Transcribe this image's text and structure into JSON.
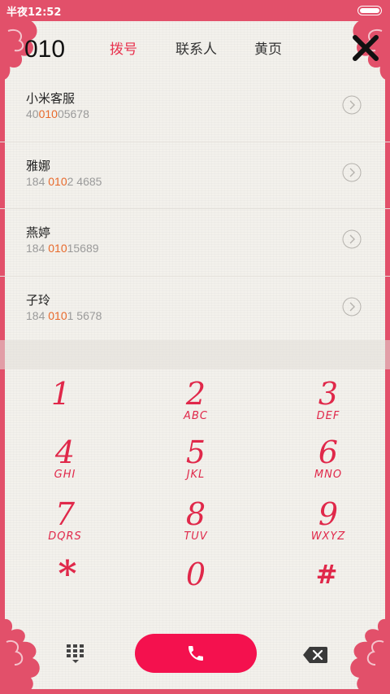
{
  "status_bar": {
    "time": "半夜12:52",
    "battery_icon": "battery-icon"
  },
  "colors": {
    "accent": "#e8334f",
    "frame": "#e2506a",
    "call": "#f4114e",
    "highlight": "#e8692b"
  },
  "header": {
    "dialed_number": "010",
    "tabs": [
      {
        "label": "拨号",
        "active": true
      },
      {
        "label": "联系人",
        "active": false
      },
      {
        "label": "黄页",
        "active": false
      }
    ],
    "close_icon": "close-icon"
  },
  "results": [
    {
      "name": "小米客服",
      "num_pre": "40",
      "num_match": "010",
      "num_post": "05678"
    },
    {
      "name": "雅娜",
      "num_pre": "184 ",
      "num_match": "010",
      "num_post": "2 4685"
    },
    {
      "name": "燕婷",
      "num_pre": "184 ",
      "num_match": "010",
      "num_post": "15689"
    },
    {
      "name": "子玲",
      "num_pre": "184 ",
      "num_match": "010",
      "num_post": "1 5678"
    }
  ],
  "keypad": [
    {
      "digit": "1",
      "letters": ""
    },
    {
      "digit": "2",
      "letters": "ABC"
    },
    {
      "digit": "3",
      "letters": "DEF"
    },
    {
      "digit": "4",
      "letters": "GHI"
    },
    {
      "digit": "5",
      "letters": "JKL"
    },
    {
      "digit": "6",
      "letters": "MNO"
    },
    {
      "digit": "7",
      "letters": "DQRS"
    },
    {
      "digit": "8",
      "letters": "TUV"
    },
    {
      "digit": "9",
      "letters": "WXYZ"
    },
    {
      "digit": "*",
      "letters": ""
    },
    {
      "digit": "0",
      "letters": ""
    },
    {
      "digit": "#",
      "letters": ""
    }
  ],
  "bottom": {
    "dialpad_icon": "dialpad-icon",
    "call_icon": "phone-icon",
    "backspace_icon": "backspace-icon"
  }
}
